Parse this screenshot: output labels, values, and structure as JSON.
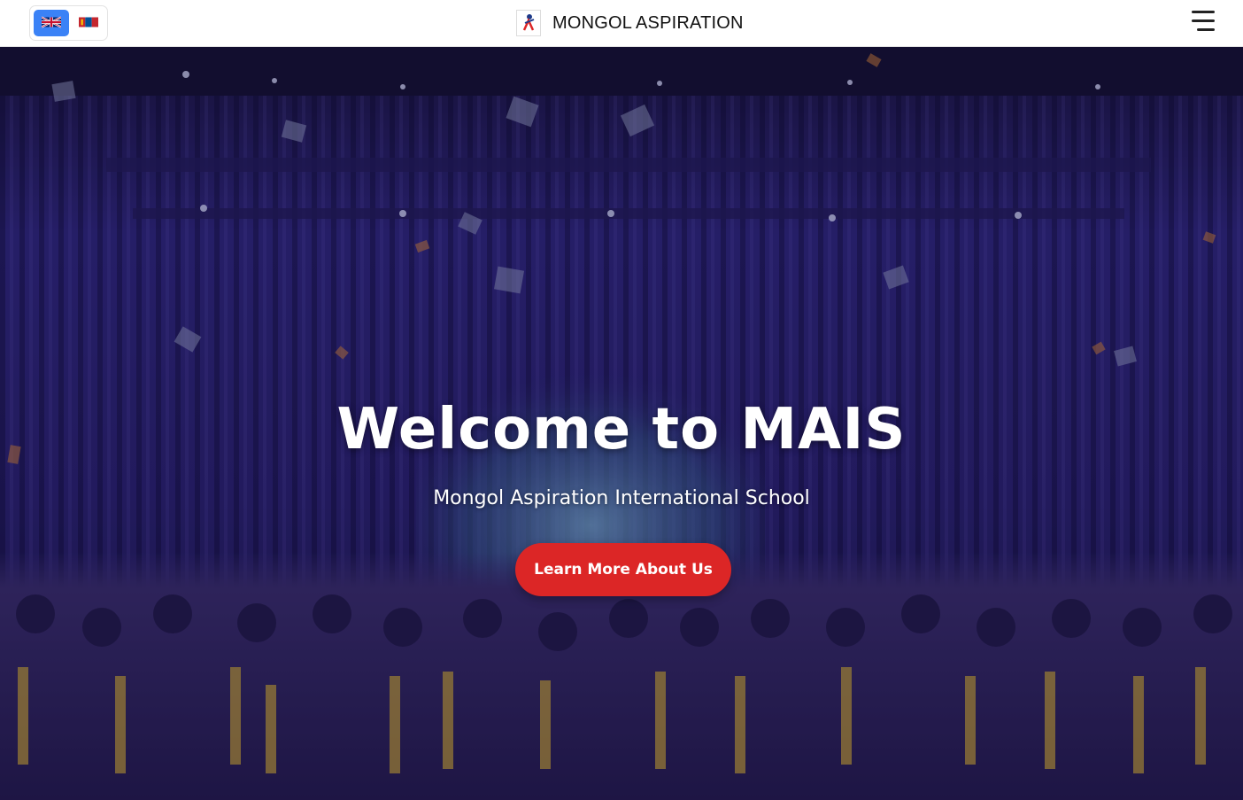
{
  "navbar": {
    "brand_title": "MONGOL ASPIRATION",
    "languages": [
      {
        "code": "en",
        "flag_icon": "uk-flag-icon",
        "active": true
      },
      {
        "code": "mn",
        "flag_icon": "mongolia-flag-icon",
        "active": false
      }
    ],
    "menu_icon": "hamburger-menu-icon"
  },
  "hero": {
    "title": "Welcome to MAIS",
    "subtitle": "Mongol Aspiration International School",
    "cta_label": "Learn More About Us",
    "background": "graduation-ceremony-photo"
  },
  "colors": {
    "cta": "#dc2626",
    "active_language": "#3b82f6",
    "hero_overlay": "#2a1f6e"
  }
}
